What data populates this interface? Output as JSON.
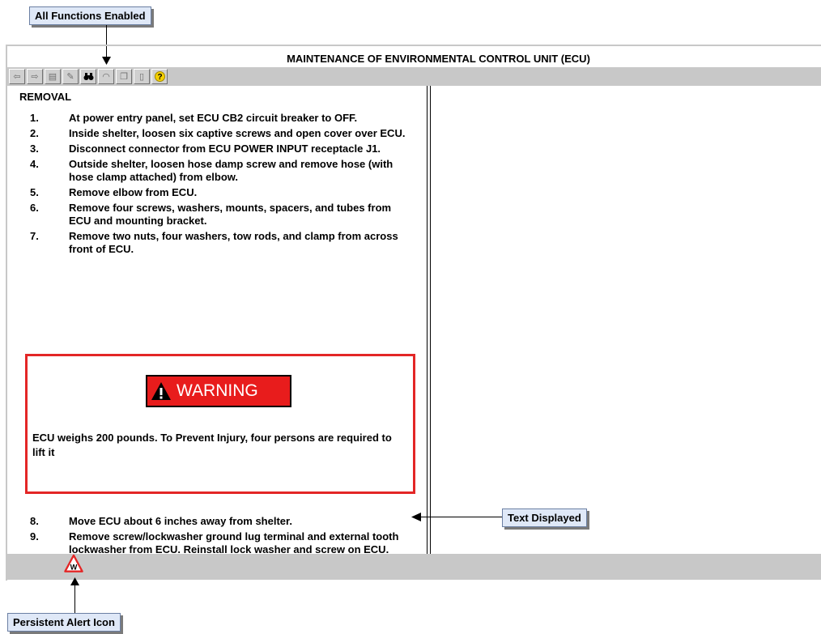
{
  "annotations": {
    "all_functions": "All Functions Enabled",
    "text_displayed": "Text Displayed",
    "alert_icon": "Persistent Alert Icon"
  },
  "window": {
    "title": "MAINTENANCE OF ENVIRONMENTAL CONTROL UNIT (ECU)"
  },
  "toolbar": {
    "buttons": [
      {
        "name": "back-arrow-icon",
        "glyph": "⇦"
      },
      {
        "name": "forward-arrow-icon",
        "glyph": "⇨"
      },
      {
        "name": "save-icon",
        "glyph": "▤"
      },
      {
        "name": "pen-icon",
        "glyph": "✎"
      },
      {
        "name": "binoculars-icon",
        "glyph": "⚭"
      },
      {
        "name": "gauge-icon",
        "glyph": "◠"
      },
      {
        "name": "bookmark-icon",
        "glyph": "❐"
      },
      {
        "name": "document-icon",
        "glyph": "▯"
      },
      {
        "name": "help-icon",
        "glyph": "?"
      }
    ]
  },
  "procedure": {
    "heading": "REMOVAL",
    "steps_part1": [
      {
        "num": "1.",
        "text": "At power entry panel, set ECU CB2 circuit breaker to OFF."
      },
      {
        "num": "2.",
        "text": "Inside shelter, loosen six captive screws and open cover over ECU."
      },
      {
        "num": "3.",
        "text": "Disconnect connector from ECU POWER INPUT receptacle J1."
      },
      {
        "num": "4.",
        "text": "Outside shelter, loosen hose damp screw and remove hose (with hose clamp attached) from elbow."
      },
      {
        "num": "5.",
        "text": "Remove elbow from ECU."
      },
      {
        "num": "6.",
        "text": "Remove four screws, washers, mounts, spacers, and tubes from ECU and mounting bracket."
      },
      {
        "num": "7.",
        "text": "Remove two nuts, four washers, tow rods, and clamp from across front of ECU."
      }
    ],
    "warning": {
      "label": "WARNING",
      "text": "ECU weighs 200 pounds. To Prevent Injury, four persons are required to lift it"
    },
    "steps_part2": [
      {
        "num": "8.",
        "text": "Move ECU about 6 inches away from shelter."
      },
      {
        "num": "9.",
        "text": "Remove screw/lockwasher ground lug terminal and external tooth lockwasher from ECU. Reinstall lock washer and screw on ECU."
      }
    ]
  },
  "status": {
    "alert_letter": "W"
  },
  "colors": {
    "warning_red": "#e32626",
    "callout_bg": "#dfe8f7",
    "bar_gray": "#c8c8c8"
  }
}
